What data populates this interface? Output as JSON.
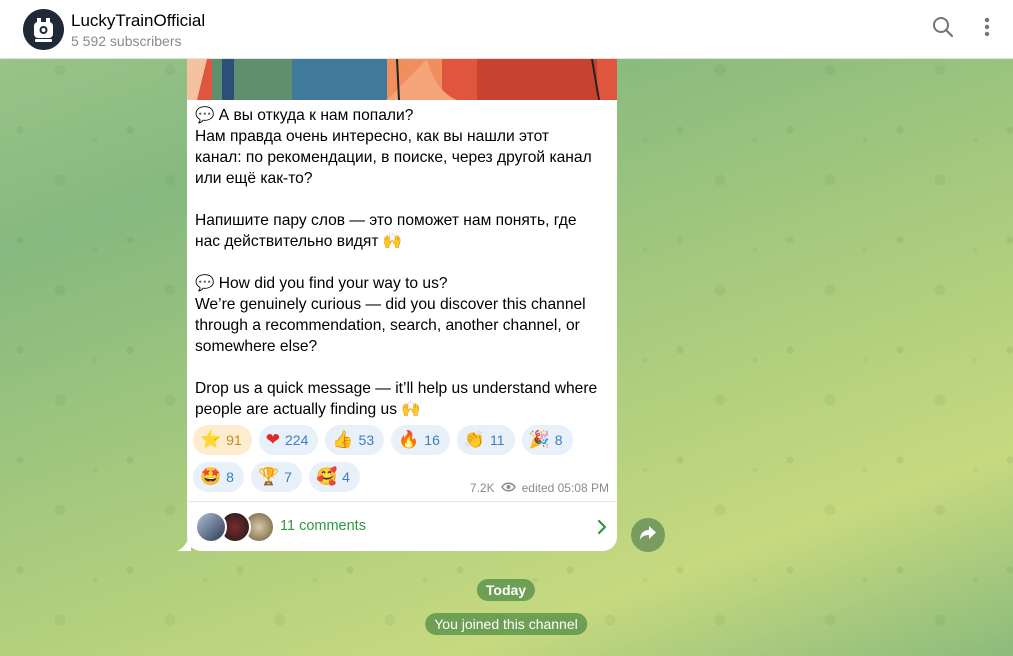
{
  "header": {
    "title": "LuckyTrainOfficial",
    "subscribers": "5 592 subscribers",
    "search_icon": "search-icon",
    "menu_icon": "more-vertical-icon"
  },
  "message": {
    "lines": [
      "💬 А вы откуда к нам попали?",
      "Нам правда очень интересно, как вы нашли этот",
      "канал: по рекомендации, в поиске, через другой канал",
      "или ещё как-то?",
      "",
      "Напишите пару слов — это поможет нам понять, где",
      "нас действительно видят 🙌",
      "",
      "💬 How did you find your way to us?",
      "We’re genuinely curious — did you discover this channel",
      "through a recommendation, search, another channel, or",
      "somewhere else?",
      "",
      "Drop us a quick message — it’ll help us understand where",
      "people are actually finding us 🙌"
    ],
    "reactions": [
      {
        "emoji": "⭐",
        "count": "91",
        "active": true
      },
      {
        "emoji": "❤",
        "count": "224"
      },
      {
        "emoji": "👍",
        "count": "53"
      },
      {
        "emoji": "🔥",
        "count": "16"
      },
      {
        "emoji": "👏",
        "count": "11"
      },
      {
        "emoji": "🎉",
        "count": "8"
      },
      {
        "emoji": "🤩",
        "count": "8"
      },
      {
        "emoji": "🏆",
        "count": "7"
      },
      {
        "emoji": "🥰",
        "count": "4"
      }
    ],
    "views": "7.2K",
    "edited": "edited 05:08 PM",
    "comments_label": "11 comments"
  },
  "service": {
    "date": "Today",
    "joined": "You joined this channel"
  },
  "colors": {
    "accent_green": "#2e9a3c",
    "reaction_blue": "#3b7ec6",
    "reaction_active": "#fdeccd"
  }
}
